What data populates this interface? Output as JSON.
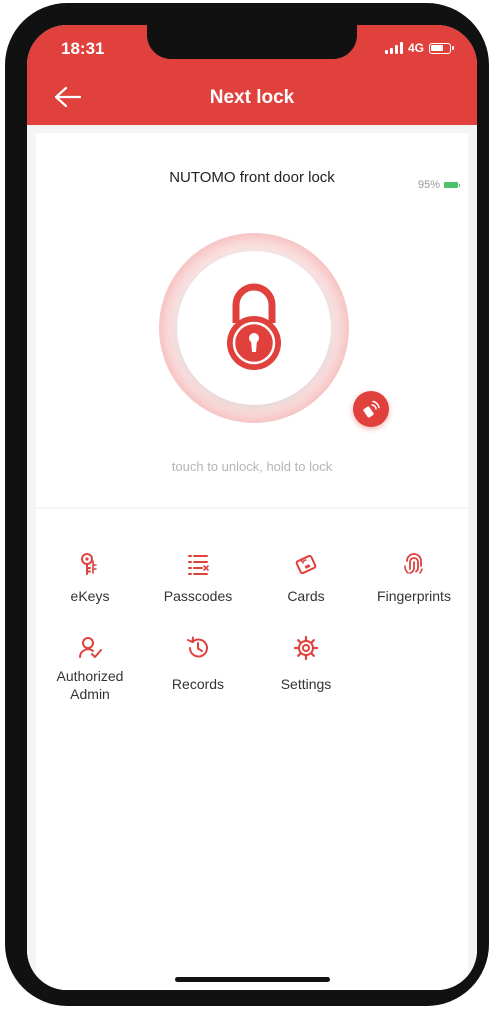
{
  "status_bar": {
    "time": "18:31",
    "network": "4G"
  },
  "header": {
    "title": "Next lock"
  },
  "lock": {
    "name": "NUTOMO front door lock",
    "battery": "95%",
    "hint": "touch to unlock, hold to lock"
  },
  "menu": {
    "ekeys": "eKeys",
    "passcodes": "Passcodes",
    "cards": "Cards",
    "fingerprints": "Fingerprints",
    "admin_line1": "Authorized",
    "admin_line2": "Admin",
    "records": "Records",
    "settings": "Settings"
  },
  "colors": {
    "accent": "#e0413c",
    "battery": "#4cc36a"
  }
}
